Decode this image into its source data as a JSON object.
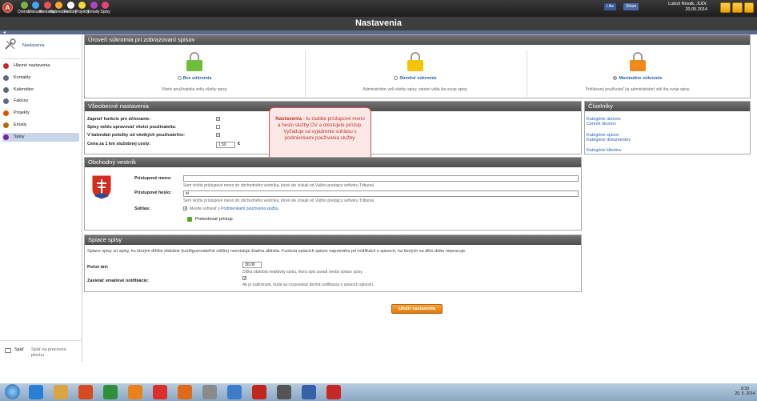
{
  "topbar": {
    "nav": [
      {
        "label": "Domov",
        "color": "#7cb342"
      },
      {
        "label": "Diskusie",
        "color": "#42a5f5"
      },
      {
        "label": "Kontakty",
        "color": "#ef5350"
      },
      {
        "label": "Kalendáre",
        "color": "#ffa726"
      },
      {
        "label": "Faktúry",
        "color": "#ffffff"
      },
      {
        "label": "Projekty",
        "color": "#fdd835"
      },
      {
        "label": "Emaily",
        "color": "#ab47bc"
      },
      {
        "label": "Spisy",
        "color": "#ec407a"
      }
    ],
    "fb_like": "Like",
    "fb_share": "Share",
    "user_name": "Luboš Novák, JUDr.",
    "date": "20.05.2014"
  },
  "page_title": "Nastavenia",
  "sidebar": {
    "header": "Nastavenia",
    "items": [
      {
        "label": "Hlavné nastavenia",
        "color": "#c62828"
      },
      {
        "label": "Kontakty",
        "color": "#5d6b7d"
      },
      {
        "label": "Kalendáre",
        "color": "#5d6b7d"
      },
      {
        "label": "Faktúry",
        "color": "#5d6b7d"
      },
      {
        "label": "Projekty",
        "color": "#e65100"
      },
      {
        "label": "Emaily",
        "color": "#b26a00"
      },
      {
        "label": "Spisy",
        "color": "#7b1fa2"
      }
    ],
    "back_label": "Späť",
    "back_desc": "Späť na pracovnú plochu"
  },
  "privacy": {
    "header": "Úroveň súkromia pri zobrazovaní spisov",
    "options": [
      {
        "label": "Bez súkromia",
        "desc": "Všetci používatelia vidia všetky spisy.",
        "color": "#6fbf3a",
        "selected": false
      },
      {
        "label": "Stredné súkromie",
        "desc": "Administrátor vidí všetky spisy, ostatní vidia iba svoje spisy.",
        "color": "#f5c400",
        "selected": false
      },
      {
        "label": "Maximálne súkromie",
        "desc": "Prihlásený používateľ (ej administrátor) vidí iba svoje spisy.",
        "color": "#f08a1a",
        "selected": true
      }
    ]
  },
  "general": {
    "header": "Všeobecné nastavenia",
    "rows": [
      {
        "label": "Zapnúť funkcie pre účtovanie:",
        "checked": true
      },
      {
        "label": "Spisy môžu upravovať všetci používatelia:",
        "checked": false
      },
      {
        "label": "V kalendári položky od všetkých používateľov:",
        "checked": true
      }
    ],
    "cost_label": "Cena za 1 km služobnej cesty:",
    "cost_value": "1.50",
    "cost_unit": "€"
  },
  "tooltip": {
    "title": "Nastavenia",
    "text": " - tu zadáte prístupové meno a heslo služby OV a otestujete prístup. Vyžaduje sa vyjadrenie súhlasu s podmienkami používania služby."
  },
  "ciselniky": {
    "header": "Číselníky",
    "links": [
      "Kategórie úkonov",
      "Cenník úkonov",
      "Kategórie spisov",
      "Kategórie dokumentov",
      "Kategórie klientov"
    ]
  },
  "vestnik": {
    "header": "Obchodný vestník",
    "user_label": "Prístupové meno:",
    "user_hint": "Sem vložte prístupové meno do obchodného vestníka, ktoré ste získali od Vášho predajcu softvéru Tribunal.",
    "pass_label": "Prístupové heslo:",
    "pass_value": "ei",
    "pass_hint": "Sem vložte prístupové meno do obchodného vestníka, ktoré ste získali od Vášho predajcu softvéru Tribunal.",
    "consent_label": "Súhlas:",
    "consent_text": "Musíte súhlasiť s ",
    "consent_link": "Podmienkami používania služby.",
    "test_label": "Pretestovať prístup"
  },
  "sleeping": {
    "header": "Spiace spisy",
    "desc": "Spiace spisy sú spisy, ku ktorým dlhšie obdobie (konfigurovateľné nižšie) neexistuje žiadna aktivita. Funkcia spiacich spisov napomáha pri notifikácii o spisoch, na ktorých sa dlhú dobu nepracuje.",
    "days_label": "Počet dní:",
    "days_value": "30.00",
    "days_hint": "Dĺžka obdobia neaktivity spisu, ktorá spis zaradí medzi spiace spisy.",
    "notif_label": "Zasielať emailové notifikácie:",
    "notif_hint": "Ak je zaškrtnuté, bude sa rozposielať denná notifikácia o spiacich spisoch."
  },
  "save_label": "Uložiť nastavenia",
  "taskbar": {
    "time": "8:39",
    "date": "20. 5. 2014"
  }
}
